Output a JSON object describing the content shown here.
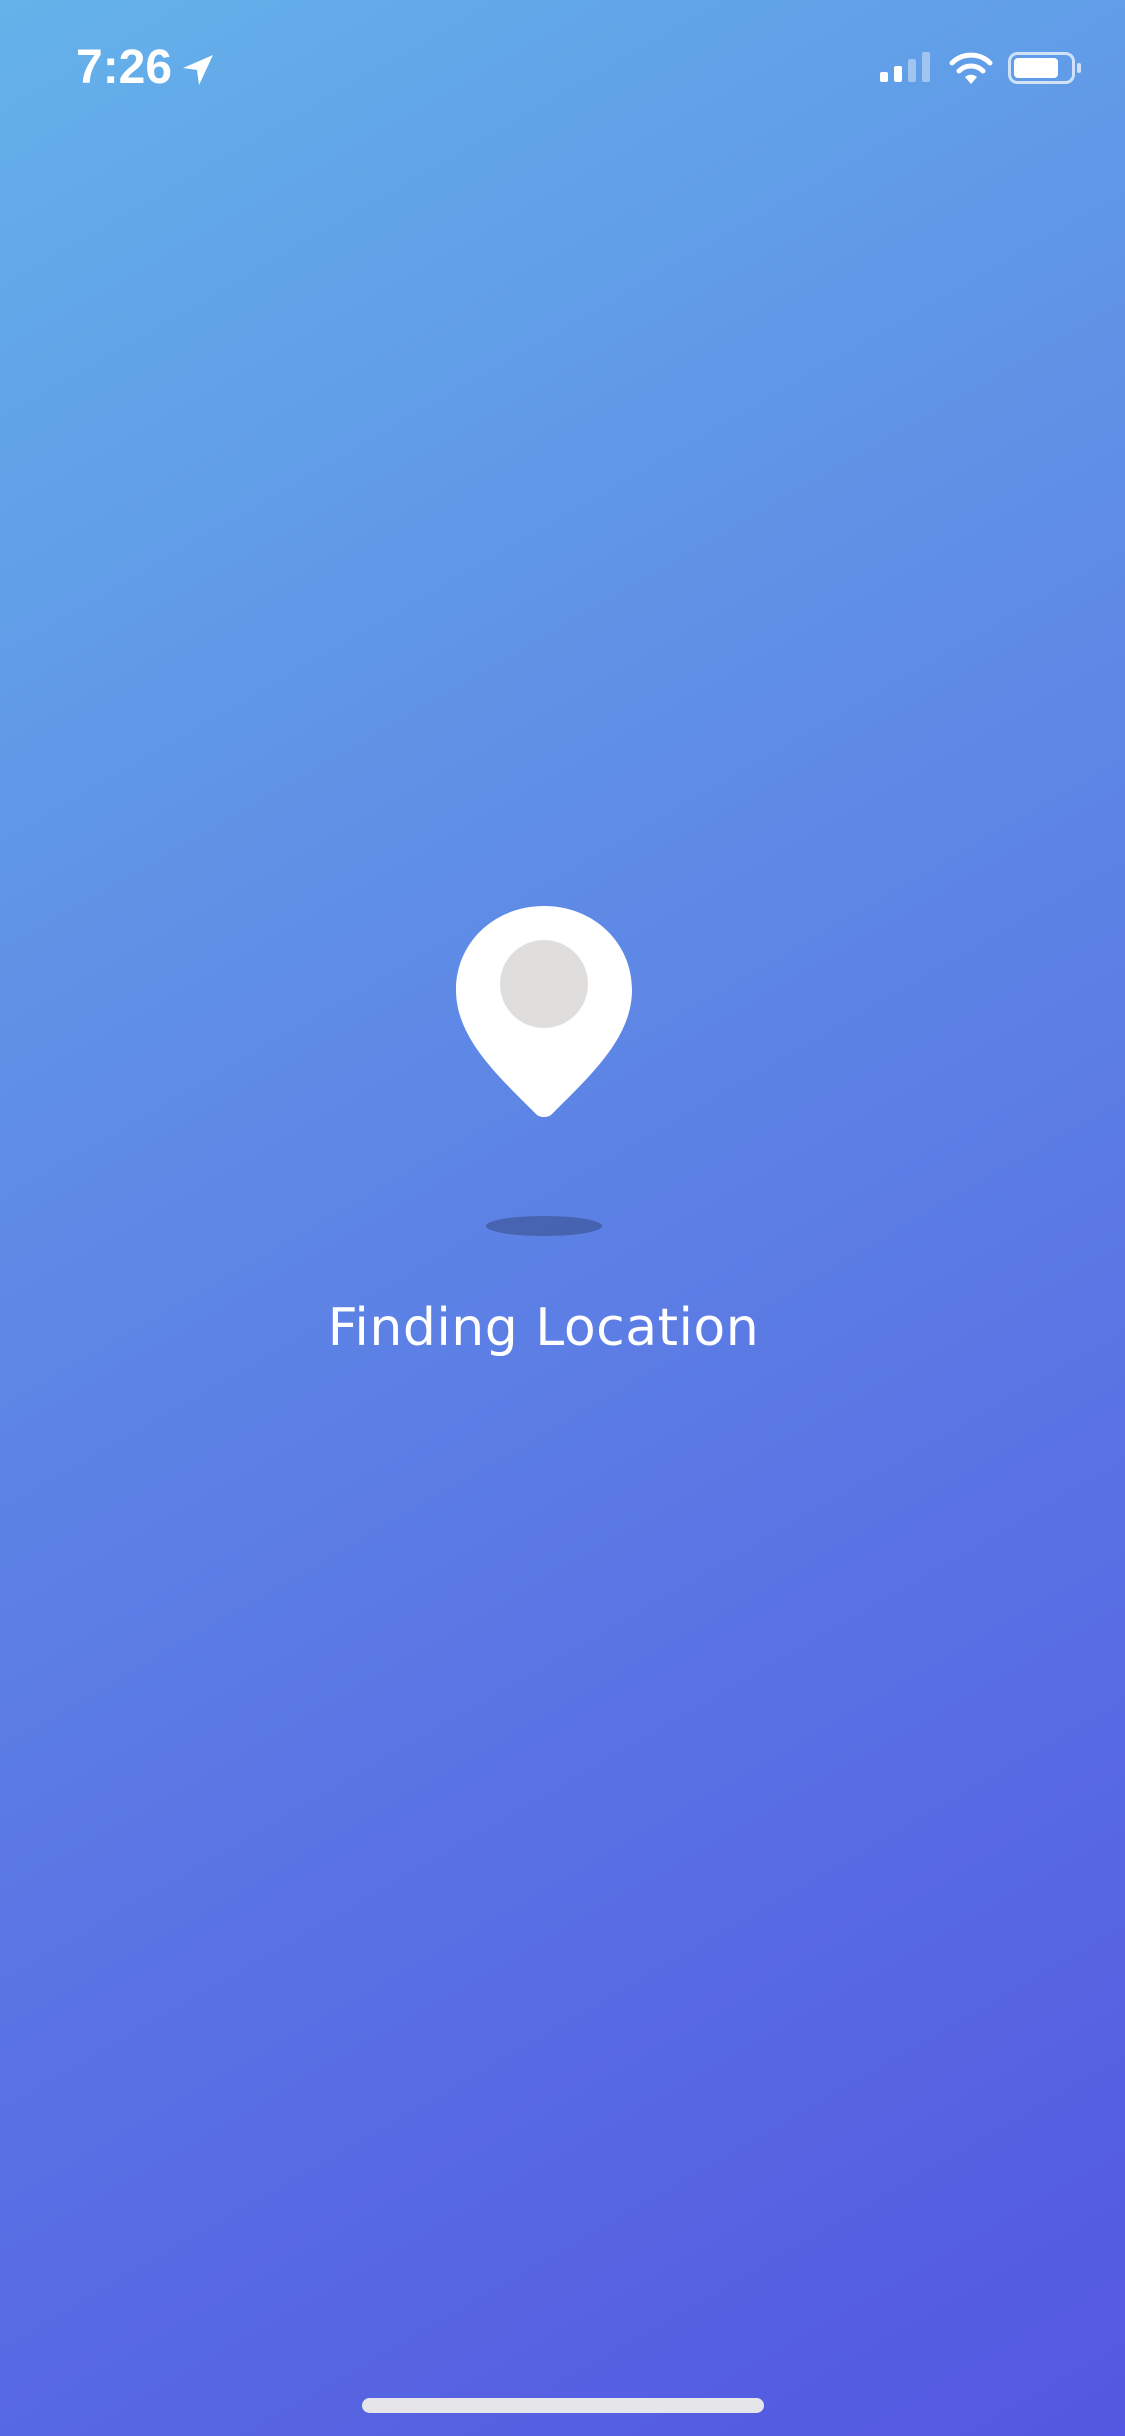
{
  "status_bar": {
    "time": "7:26",
    "icons": [
      "location-arrow-icon",
      "cellular-signal-icon",
      "wifi-icon",
      "battery-icon"
    ]
  },
  "main": {
    "icon": "location-pin-icon",
    "status_text": "Finding Location"
  },
  "colors": {
    "gradient_start": "#64B2EA",
    "gradient_end": "#5357E1",
    "pin": "#FFFFFF",
    "pin_center": "#DFDEDD",
    "shadow": "#3F5A9C"
  }
}
